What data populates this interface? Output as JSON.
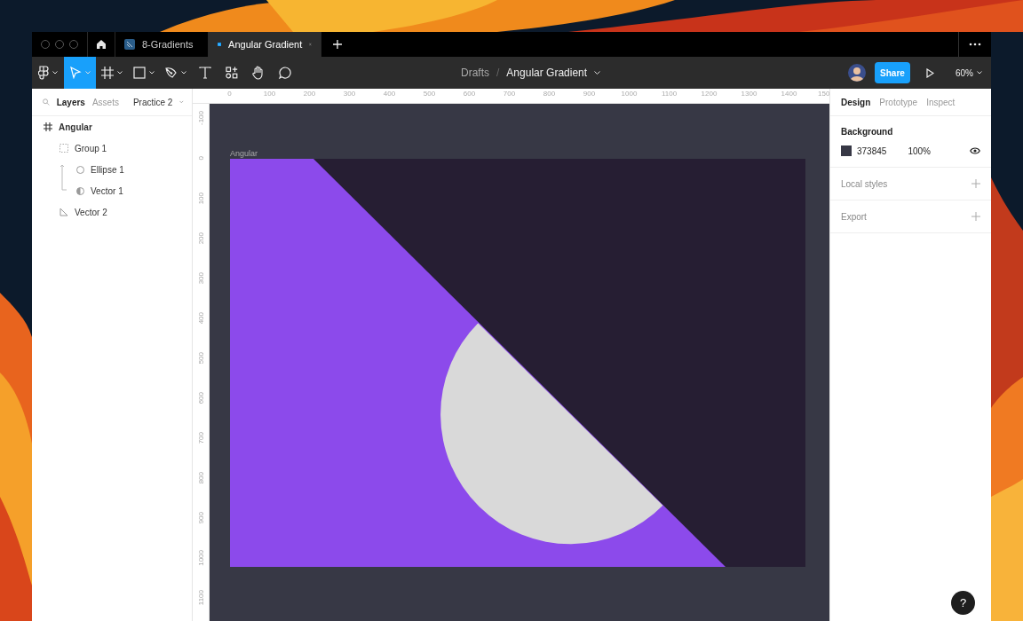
{
  "tabs": [
    {
      "label": "8-Gradients",
      "selected": false
    },
    {
      "label": "Angular Gradient",
      "selected": true
    }
  ],
  "toolbar": {
    "tools": [
      {
        "kind": "logo",
        "selected": false
      },
      {
        "kind": "move",
        "selected": true
      },
      {
        "kind": "frame",
        "selected": false
      },
      {
        "kind": "shape",
        "selected": false
      },
      {
        "kind": "pen",
        "selected": false
      },
      {
        "kind": "text",
        "selected": false
      },
      {
        "kind": "components",
        "selected": false
      },
      {
        "kind": "hand",
        "selected": false
      },
      {
        "kind": "comment",
        "selected": false
      }
    ],
    "breadcrumb": {
      "folder": "Drafts",
      "separator": "/",
      "file": "Angular Gradient"
    },
    "share": "Share",
    "zoom": "60%"
  },
  "left_panel": {
    "tabs": [
      {
        "label": "Layers",
        "selected": true
      },
      {
        "label": "Assets",
        "selected": false
      }
    ],
    "page": "Practice 2",
    "layers": [
      {
        "name": "Angular",
        "kind": "frame",
        "children": [
          {
            "name": "Group 1",
            "kind": "group",
            "children": [
              {
                "name": "Ellipse 1",
                "kind": "ellipse"
              },
              {
                "name": "Vector 1",
                "kind": "half"
              }
            ]
          },
          {
            "name": "Vector 2",
            "kind": "vector"
          }
        ]
      }
    ]
  },
  "rulers": {
    "horizontal": [
      "0",
      "100",
      "200",
      "300",
      "400",
      "500",
      "600",
      "700",
      "800",
      "900",
      "1000",
      "1100",
      "1200",
      "1300",
      "1400",
      "150"
    ],
    "vertical": [
      "-100",
      "0",
      "100",
      "200",
      "300",
      "400",
      "500",
      "600",
      "700",
      "800",
      "900",
      "1000",
      "1100"
    ]
  },
  "canvas": {
    "frame_label": "Angular"
  },
  "right_panel": {
    "tabs": [
      {
        "label": "Design",
        "selected": true
      },
      {
        "label": "Prototype",
        "selected": false
      },
      {
        "label": "Inspect",
        "selected": false
      }
    ],
    "background": {
      "title": "Background",
      "hex": "373845",
      "opacity": "100%"
    },
    "sections": [
      "Local styles",
      "Export"
    ]
  },
  "help": "?"
}
